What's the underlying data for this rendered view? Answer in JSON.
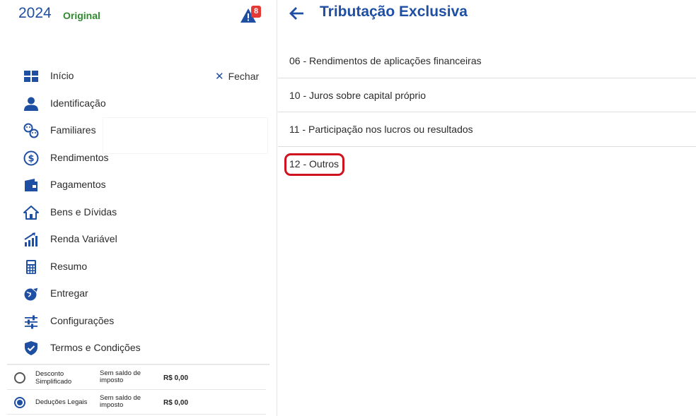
{
  "header": {
    "year": "2024",
    "declaration_type": "Original",
    "alert_count": "8"
  },
  "sidebar": {
    "close_label": "Fechar",
    "items": [
      {
        "label": "Início",
        "icon": "dashboard-icon"
      },
      {
        "label": "Identificação",
        "icon": "person-icon"
      },
      {
        "label": "Familiares",
        "icon": "family-icon"
      },
      {
        "label": "Rendimentos",
        "icon": "dollar-circle-icon"
      },
      {
        "label": "Pagamentos",
        "icon": "wallet-icon"
      },
      {
        "label": "Bens e Dívidas",
        "icon": "house-icon"
      },
      {
        "label": "Renda Variável",
        "icon": "chart-up-icon"
      },
      {
        "label": "Resumo",
        "icon": "calculator-icon"
      },
      {
        "label": "Entregar",
        "icon": "globe-send-icon"
      },
      {
        "label": "Configurações",
        "icon": "sliders-icon"
      },
      {
        "label": "Termos e Condições",
        "icon": "shield-check-icon"
      }
    ],
    "options": [
      {
        "name": "Desconto Simplificado",
        "desc": "Sem saldo de imposto",
        "value": "R$ 0,00",
        "selected": false
      },
      {
        "name": "Deduções Legais",
        "desc": "Sem saldo de imposto",
        "value": "R$ 0,00",
        "selected": true
      }
    ]
  },
  "main": {
    "title": "Tributação Exclusiva",
    "items": [
      {
        "label": "06 - Rendimentos de aplicações financeiras"
      },
      {
        "label": "10 - Juros sobre capital próprio"
      },
      {
        "label": "11 - Participação nos lucros ou resultados"
      },
      {
        "label": "12 - Outros",
        "highlighted": true
      }
    ]
  },
  "colors": {
    "accent": "#1f4fa3",
    "original_green": "#2e8b2e",
    "badge_red": "#e53935",
    "highlight_red": "#d0121f"
  }
}
